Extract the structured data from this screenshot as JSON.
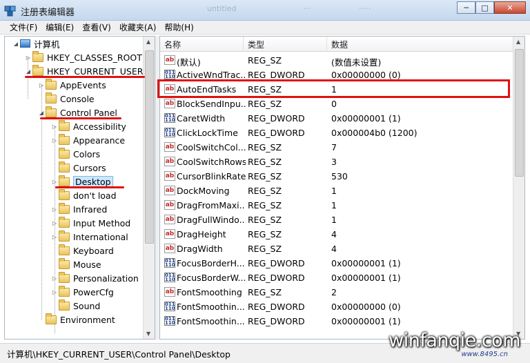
{
  "window": {
    "title": "注册表编辑器",
    "controls": {
      "minimize": "─",
      "maximize": "□",
      "close": "✕"
    },
    "ghost_tabs": [
      "untitled",
      "···",
      "·····"
    ]
  },
  "menu": [
    "文件(F)",
    "编辑(E)",
    "查看(V)",
    "收藏夹(A)",
    "帮助(H)"
  ],
  "tree": {
    "root": "计算机",
    "items": [
      {
        "label": "HKEY_CLASSES_ROOT",
        "expander": "▷"
      },
      {
        "label": "HKEY_CURRENT_USER",
        "expander": "◢"
      },
      {
        "label": "AppEvents",
        "expander": "▷"
      },
      {
        "label": "Console",
        "expander": ""
      },
      {
        "label": "Control Panel",
        "expander": "◢"
      },
      {
        "label": "Accessibility",
        "expander": "▷"
      },
      {
        "label": "Appearance",
        "expander": "▷"
      },
      {
        "label": "Colors",
        "expander": ""
      },
      {
        "label": "Cursors",
        "expander": ""
      },
      {
        "label": "Desktop",
        "expander": "▷"
      },
      {
        "label": "don't load",
        "expander": ""
      },
      {
        "label": "Infrared",
        "expander": "▷"
      },
      {
        "label": "Input Method",
        "expander": "▷"
      },
      {
        "label": "International",
        "expander": "▷"
      },
      {
        "label": "Keyboard",
        "expander": ""
      },
      {
        "label": "Mouse",
        "expander": ""
      },
      {
        "label": "Personalization",
        "expander": "▷"
      },
      {
        "label": "PowerCfg",
        "expander": "▷"
      },
      {
        "label": "Sound",
        "expander": ""
      },
      {
        "label": "Environment",
        "expander": ""
      }
    ]
  },
  "list": {
    "columns": [
      "名称",
      "类型",
      "数据"
    ],
    "rows": [
      {
        "icon": "ab",
        "name": "(默认)",
        "type": "REG_SZ",
        "data": "(数值未设置)"
      },
      {
        "icon": "bin",
        "name": "ActiveWndTrac...",
        "type": "REG_DWORD",
        "data": "0x00000000 (0)"
      },
      {
        "icon": "ab",
        "name": "AutoEndTasks",
        "type": "REG_SZ",
        "data": "1"
      },
      {
        "icon": "ab",
        "name": "BlockSendInpu...",
        "type": "REG_SZ",
        "data": "0"
      },
      {
        "icon": "bin",
        "name": "CaretWidth",
        "type": "REG_DWORD",
        "data": "0x00000001 (1)"
      },
      {
        "icon": "bin",
        "name": "ClickLockTime",
        "type": "REG_DWORD",
        "data": "0x000004b0 (1200)"
      },
      {
        "icon": "ab",
        "name": "CoolSwitchCol...",
        "type": "REG_SZ",
        "data": "7"
      },
      {
        "icon": "ab",
        "name": "CoolSwitchRows",
        "type": "REG_SZ",
        "data": "3"
      },
      {
        "icon": "ab",
        "name": "CursorBlinkRate",
        "type": "REG_SZ",
        "data": "530"
      },
      {
        "icon": "ab",
        "name": "DockMoving",
        "type": "REG_SZ",
        "data": "1"
      },
      {
        "icon": "ab",
        "name": "DragFromMaxi...",
        "type": "REG_SZ",
        "data": "1"
      },
      {
        "icon": "ab",
        "name": "DragFullWindo...",
        "type": "REG_SZ",
        "data": "1"
      },
      {
        "icon": "ab",
        "name": "DragHeight",
        "type": "REG_SZ",
        "data": "4"
      },
      {
        "icon": "ab",
        "name": "DragWidth",
        "type": "REG_SZ",
        "data": "4"
      },
      {
        "icon": "bin",
        "name": "FocusBorderH...",
        "type": "REG_DWORD",
        "data": "0x00000001 (1)"
      },
      {
        "icon": "bin",
        "name": "FocusBorderW...",
        "type": "REG_DWORD",
        "data": "0x00000001 (1)"
      },
      {
        "icon": "ab",
        "name": "FontSmoothing",
        "type": "REG_SZ",
        "data": "2"
      },
      {
        "icon": "bin",
        "name": "FontSmoothin...",
        "type": "REG_DWORD",
        "data": "0x00000000 (0)"
      },
      {
        "icon": "bin",
        "name": "FontSmoothin...",
        "type": "REG_DWORD",
        "data": "0x00000001 (1)"
      }
    ]
  },
  "icon_glyphs": {
    "ab": "ab",
    "bin": "011\n110"
  },
  "status": "计算机\\HKEY_CURRENT_USER\\Control Panel\\Desktop",
  "watermark": {
    "main": "winfanqie.com",
    "sub": "www.8495.cn"
  },
  "colors": {
    "highlight_red": "#e01010",
    "selection": "#cce8ff"
  }
}
